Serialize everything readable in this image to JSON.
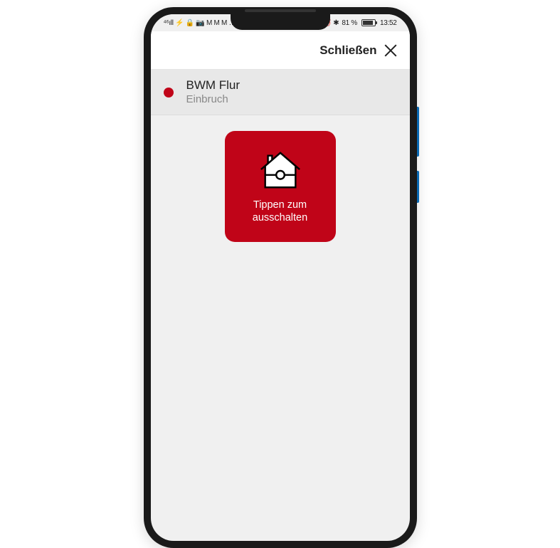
{
  "status": {
    "left": "⁴⁶ıll ⚡ 🔒 📷 M M M …",
    "right_icons": "👁 ℕ ⏰ ✱",
    "battery_pct": "81 %",
    "time": "13:52"
  },
  "header": {
    "close_label": "Schließen"
  },
  "alarm": {
    "title": "BWM Flur",
    "subtitle": "Einbruch"
  },
  "button": {
    "label": "Tippen zum\nausschalten"
  },
  "colors": {
    "brand_red": "#c00418"
  }
}
